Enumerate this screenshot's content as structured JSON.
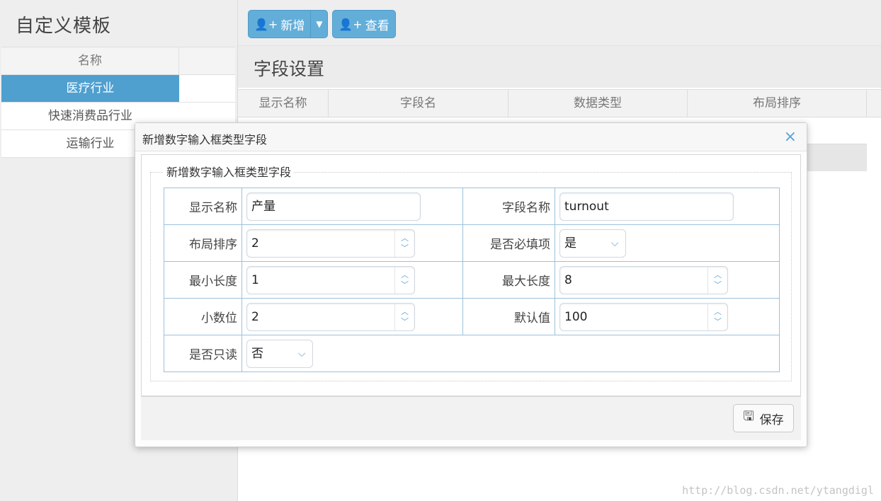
{
  "left": {
    "title": "自定义模板",
    "header": "名称",
    "items": [
      {
        "label": "医疗行业",
        "selected": true
      },
      {
        "label": "快速消费品行业",
        "selected": false
      },
      {
        "label": "运输行业",
        "selected": false
      }
    ]
  },
  "toolbar": {
    "add_label": "新增",
    "view_label": "查看"
  },
  "main": {
    "section_title": "字段设置",
    "columns": [
      "显示名称",
      "字段名",
      "数据类型",
      "布局排序"
    ]
  },
  "dialog": {
    "title": "新增数字输入框类型字段",
    "legend": "新增数字输入框类型字段",
    "close_glyph": "×",
    "fields": {
      "display_name": {
        "label": "显示名称",
        "value": "产量"
      },
      "field_name": {
        "label": "字段名称",
        "value": "turnout"
      },
      "layout_order": {
        "label": "布局排序",
        "value": "2"
      },
      "required": {
        "label": "是否必填项",
        "value": "是"
      },
      "min_length": {
        "label": "最小长度",
        "value": "1"
      },
      "max_length": {
        "label": "最大长度",
        "value": "8"
      },
      "decimals": {
        "label": "小数位",
        "value": "2"
      },
      "default_value": {
        "label": "默认值",
        "value": "100"
      },
      "readonly": {
        "label": "是否只读",
        "value": "否"
      }
    },
    "save_label": "保存"
  },
  "watermark": "http://blog.csdn.net/ytangdigl",
  "colors": {
    "accent": "#4f9fcf",
    "button": "#63aed9",
    "table_border": "#9dc1dc"
  }
}
